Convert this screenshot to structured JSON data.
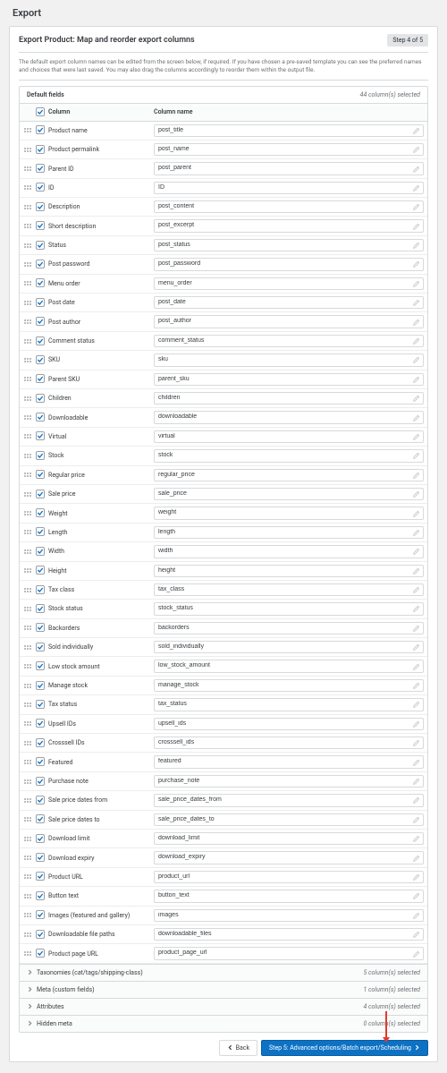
{
  "page_title": "Export",
  "panel": {
    "title": "Export Product: Map and reorder export columns",
    "step_badge": "Step 4 of 5",
    "description": "The default export column names can be edited from the screen below, if required. If you have chosen a pre-saved template you can see the preferred names and choices that were last saved. You may also drag the columns accordingly to reorder them within the output file."
  },
  "default_fields": {
    "label": "Default fields",
    "count_text": "44 column(s) selected",
    "headers": {
      "column": "Column",
      "column_name": "Column name"
    },
    "rows": [
      {
        "col": "Product name",
        "name": "post_title"
      },
      {
        "col": "Product permalink",
        "name": "post_name"
      },
      {
        "col": "Parent ID",
        "name": "post_parent"
      },
      {
        "col": "ID",
        "name": "ID"
      },
      {
        "col": "Description",
        "name": "post_content"
      },
      {
        "col": "Short description",
        "name": "post_excerpt"
      },
      {
        "col": "Status",
        "name": "post_status"
      },
      {
        "col": "Post password",
        "name": "post_password"
      },
      {
        "col": "Menu order",
        "name": "menu_order"
      },
      {
        "col": "Post date",
        "name": "post_date"
      },
      {
        "col": "Post author",
        "name": "post_author"
      },
      {
        "col": "Comment status",
        "name": "comment_status"
      },
      {
        "col": "SKU",
        "name": "sku"
      },
      {
        "col": "Parent SKU",
        "name": "parent_sku"
      },
      {
        "col": "Children",
        "name": "children"
      },
      {
        "col": "Downloadable",
        "name": "downloadable"
      },
      {
        "col": "Virtual",
        "name": "virtual"
      },
      {
        "col": "Stock",
        "name": "stock"
      },
      {
        "col": "Regular price",
        "name": "regular_price"
      },
      {
        "col": "Sale price",
        "name": "sale_price"
      },
      {
        "col": "Weight",
        "name": "weight"
      },
      {
        "col": "Length",
        "name": "length"
      },
      {
        "col": "Width",
        "name": "width"
      },
      {
        "col": "Height",
        "name": "height"
      },
      {
        "col": "Tax class",
        "name": "tax_class"
      },
      {
        "col": "Stock status",
        "name": "stock_status"
      },
      {
        "col": "Backorders",
        "name": "backorders"
      },
      {
        "col": "Sold individually",
        "name": "sold_individually"
      },
      {
        "col": "Low stock amount",
        "name": "low_stock_amount"
      },
      {
        "col": "Manage stock",
        "name": "manage_stock"
      },
      {
        "col": "Tax status",
        "name": "tax_status"
      },
      {
        "col": "Upsell IDs",
        "name": "upsell_ids"
      },
      {
        "col": "Crosssell IDs",
        "name": "crosssell_ids"
      },
      {
        "col": "Featured",
        "name": "featured"
      },
      {
        "col": "Purchase note",
        "name": "purchase_note"
      },
      {
        "col": "Sale price dates from",
        "name": "sale_price_dates_from"
      },
      {
        "col": "Sale price dates to",
        "name": "sale_price_dates_to"
      },
      {
        "col": "Download limit",
        "name": "download_limit"
      },
      {
        "col": "Download expiry",
        "name": "download_expiry"
      },
      {
        "col": "Product URL",
        "name": "product_url"
      },
      {
        "col": "Button text",
        "name": "button_text"
      },
      {
        "col": "Images (featured and gallery)",
        "name": "images"
      },
      {
        "col": "Downloadable file paths",
        "name": "downloadable_files"
      },
      {
        "col": "Product page URL",
        "name": "product_page_url"
      }
    ]
  },
  "accordions": [
    {
      "label": "Taxonomies (cat/tags/shipping-class)",
      "count": "5 column(s) selected"
    },
    {
      "label": "Meta (custom fields)",
      "count": "1 column(s) selected"
    },
    {
      "label": "Attributes",
      "count": "4 column(s) selected"
    },
    {
      "label": "Hidden meta",
      "count": "0 column(s) selected"
    }
  ],
  "footer": {
    "back": "Back",
    "next": "Step 5: Advanced options/Batch export/Scheduling"
  }
}
